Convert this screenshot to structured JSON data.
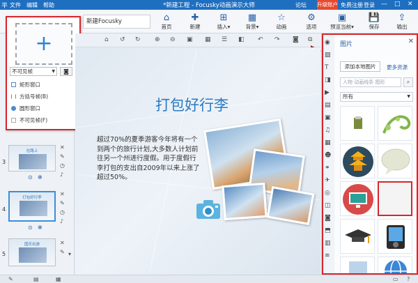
{
  "titlebar": {
    "app_icon": "平",
    "menu": [
      "文件",
      "编辑",
      "帮助"
    ],
    "title": "*新建工程 - Focusky动画演示大师",
    "forum": "论坛",
    "upgrade": "升级账户",
    "free_register": "免费注册",
    "login": "登录",
    "minimize": "—",
    "maximize": "□",
    "close": "✕"
  },
  "toolbar": {
    "doc_name": "新建Focusky",
    "buttons": [
      {
        "label": "首页",
        "icon": "home-icon"
      },
      {
        "label": "新建",
        "icon": "new-icon"
      },
      {
        "label": "插入",
        "icon": "insert-icon",
        "dropdown": true
      },
      {
        "label": "背景",
        "icon": "background-icon",
        "dropdown": true
      },
      {
        "label": "动画",
        "icon": "star-animation-icon"
      },
      {
        "label": "选项",
        "icon": "gear-icon"
      },
      {
        "label": "预览当前",
        "icon": "preview-icon",
        "dropdown": true
      },
      {
        "label": "保存",
        "icon": "save-icon"
      },
      {
        "label": "输出",
        "icon": "export-icon"
      }
    ]
  },
  "frame_popover": {
    "add_symbol": "+",
    "select_value": "不可见帧",
    "options": [
      "矩形窗口",
      "方括号帧(B)",
      "圆形窗口",
      "不可见帧(F)"
    ]
  },
  "slides": [
    {
      "num": "3",
      "title": "在路上"
    },
    {
      "num": "4",
      "title": "打包好行李"
    },
    {
      "num": "5",
      "title": "国庆出游"
    }
  ],
  "canvas": {
    "title": "打包好行李",
    "body": "超过70%的夏季游客今年将有一个到两个的旅行计划,大多数人计划前往另一个州进行度假。用于度假行李打包的支出自2009年以来上涨了超过50%。"
  },
  "picture_panel": {
    "title": "图片",
    "add_local": "添加本地图片",
    "more_resources": "更多资源",
    "search_placeholder": "人物 动画线条 图形",
    "filter_value": "所有"
  },
  "colors": {
    "titlebar": "#1f6fc1",
    "highlight": "#d6262c",
    "accent": "#2a7ac4",
    "upgrade": "#e8482e"
  }
}
